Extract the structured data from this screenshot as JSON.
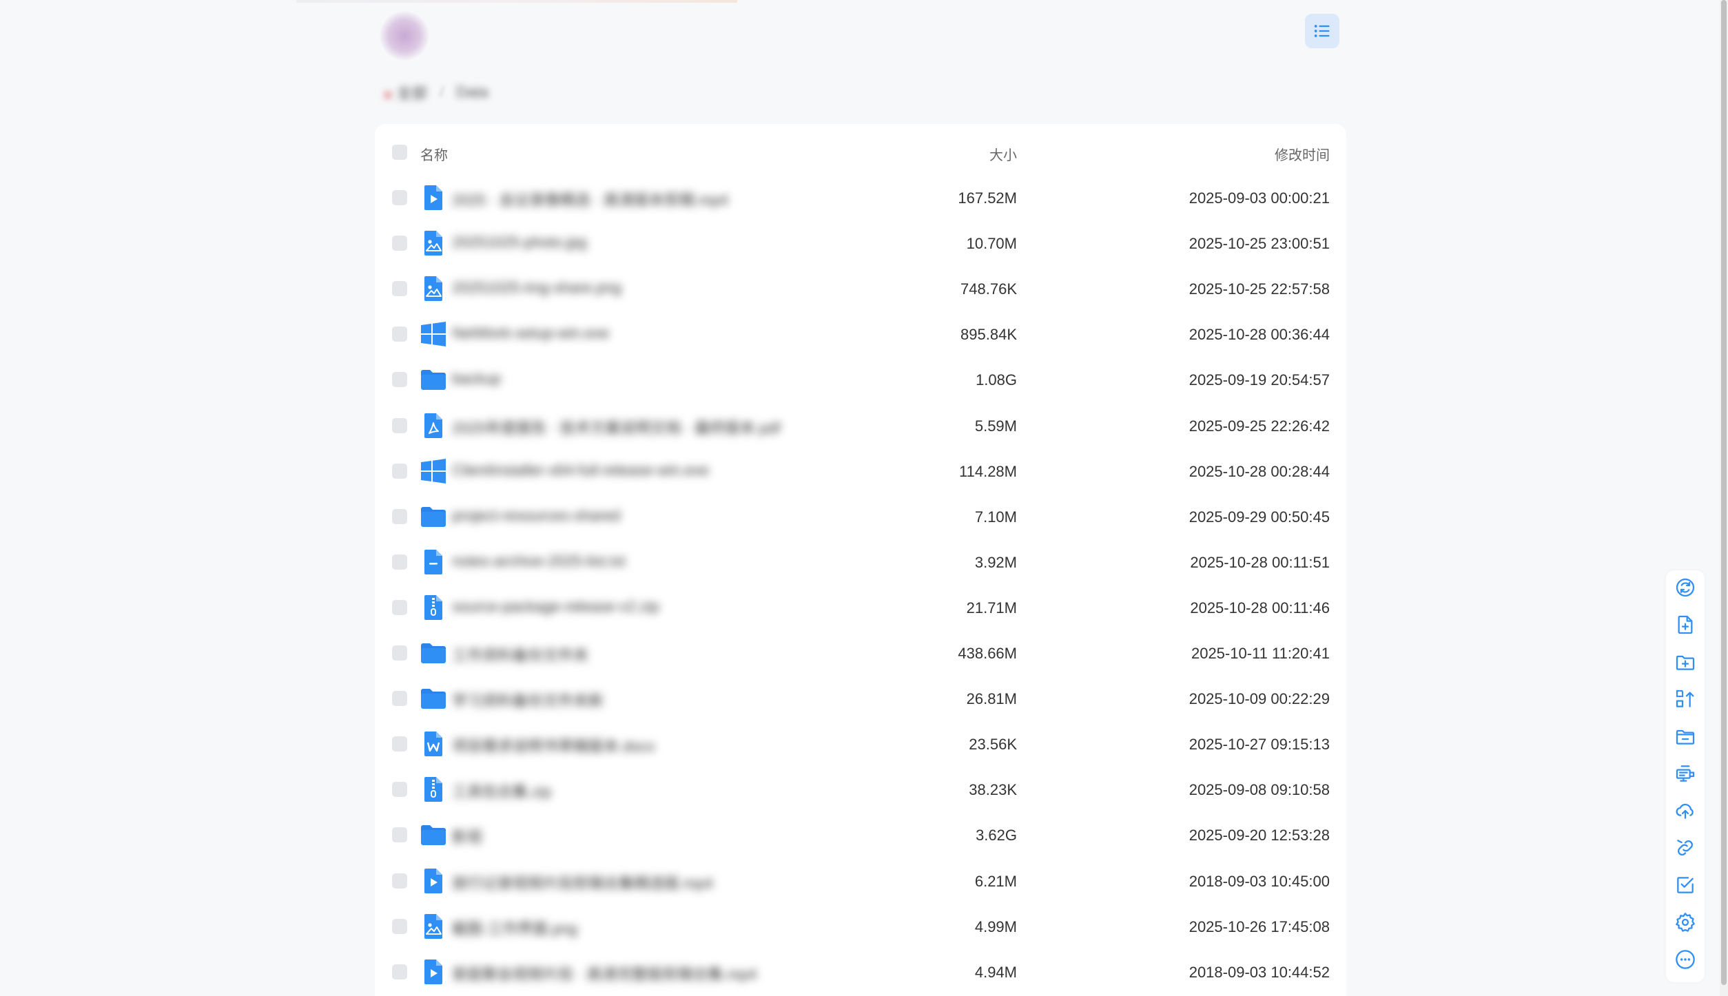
{
  "header": {
    "avatar_icon": "avatar",
    "view_toggle_icon": "list-view-icon"
  },
  "breadcrumb": [
    "全部",
    "Data"
  ],
  "columns": {
    "name": "名称",
    "size": "大小",
    "modified": "修改时间"
  },
  "files": [
    {
      "icon": "video",
      "name": "2025 · 会议录像精选 · 高清版本剪辑.mp4",
      "size": "167.52M",
      "modified": "2025-09-03 00:00:21"
    },
    {
      "icon": "image",
      "name": "20251025-photo.jpg",
      "size": "10.70M",
      "modified": "2025-10-25 23:00:51"
    },
    {
      "icon": "image",
      "name": "20251025-img-share.png",
      "size": "748.76K",
      "modified": "2025-10-25 22:57:58"
    },
    {
      "icon": "windows",
      "name": "NetWork-setup-win.exe",
      "size": "895.84K",
      "modified": "2025-10-28 00:36:44"
    },
    {
      "icon": "folder",
      "name": "backup",
      "size": "1.08G",
      "modified": "2025-09-19 20:54:57"
    },
    {
      "icon": "pdf",
      "name": "2025年度报告 · 技术方案说明文档 · 最终版本.pdf",
      "size": "5.59M",
      "modified": "2025-09-25 22:26:42"
    },
    {
      "icon": "windows",
      "name": "ClientInstaller-x64-full-release-win.exe",
      "size": "114.28M",
      "modified": "2025-10-28 00:28:44"
    },
    {
      "icon": "folder",
      "name": "project-resources-shared",
      "size": "7.10M",
      "modified": "2025-09-29 00:50:45"
    },
    {
      "icon": "doc",
      "name": "notes-archive-2025-list.txt",
      "size": "3.92M",
      "modified": "2025-10-28 00:11:51"
    },
    {
      "icon": "zip",
      "name": "source-package-release-v2.zip",
      "size": "21.71M",
      "modified": "2025-10-28 00:11:46"
    },
    {
      "icon": "folder",
      "name": "工作资料备份文件夹",
      "size": "438.66M",
      "modified": "2025-10-11 11:20:41"
    },
    {
      "icon": "folder",
      "name": "学习资料备份文件夹新",
      "size": "26.81M",
      "modified": "2025-10-09 00:22:29"
    },
    {
      "icon": "word",
      "name": "项目需求说明书草稿版本.docx",
      "size": "23.56K",
      "modified": "2025-10-27 09:15:13"
    },
    {
      "icon": "zip",
      "name": "工具包合集.zip",
      "size": "38.23K",
      "modified": "2025-09-08 09:10:58"
    },
    {
      "icon": "folder",
      "name": "影视",
      "size": "3.62G",
      "modified": "2025-09-20 12:53:28"
    },
    {
      "icon": "video",
      "name": "旅行记录视频片段剪辑合集精选版.mp4",
      "size": "6.21M",
      "modified": "2018-09-03 10:45:00"
    },
    {
      "icon": "image",
      "name": "截图-工作界面.png",
      "size": "4.99M",
      "modified": "2025-10-26 17:45:08"
    },
    {
      "icon": "video",
      "name": "家庭聚会视频片段 · 高清完整版剪辑合集.mp4",
      "size": "4.94M",
      "modified": "2018-09-03 10:44:52"
    }
  ],
  "toolbar": [
    {
      "name": "refresh-icon"
    },
    {
      "name": "new-file-icon"
    },
    {
      "name": "new-folder-icon"
    },
    {
      "name": "sort-icon"
    },
    {
      "name": "folder-minus-icon"
    },
    {
      "name": "remote-upload-icon"
    },
    {
      "name": "upload-cloud-icon"
    },
    {
      "name": "link-icon"
    },
    {
      "name": "select-checkbox-icon"
    },
    {
      "name": "settings-gear-icon"
    },
    {
      "name": "more-icon"
    }
  ],
  "colors": {
    "accent": "#2f8ff5",
    "background": "#f7f8fa",
    "panel": "#ffffff",
    "checkbox": "#e4e6ea"
  }
}
